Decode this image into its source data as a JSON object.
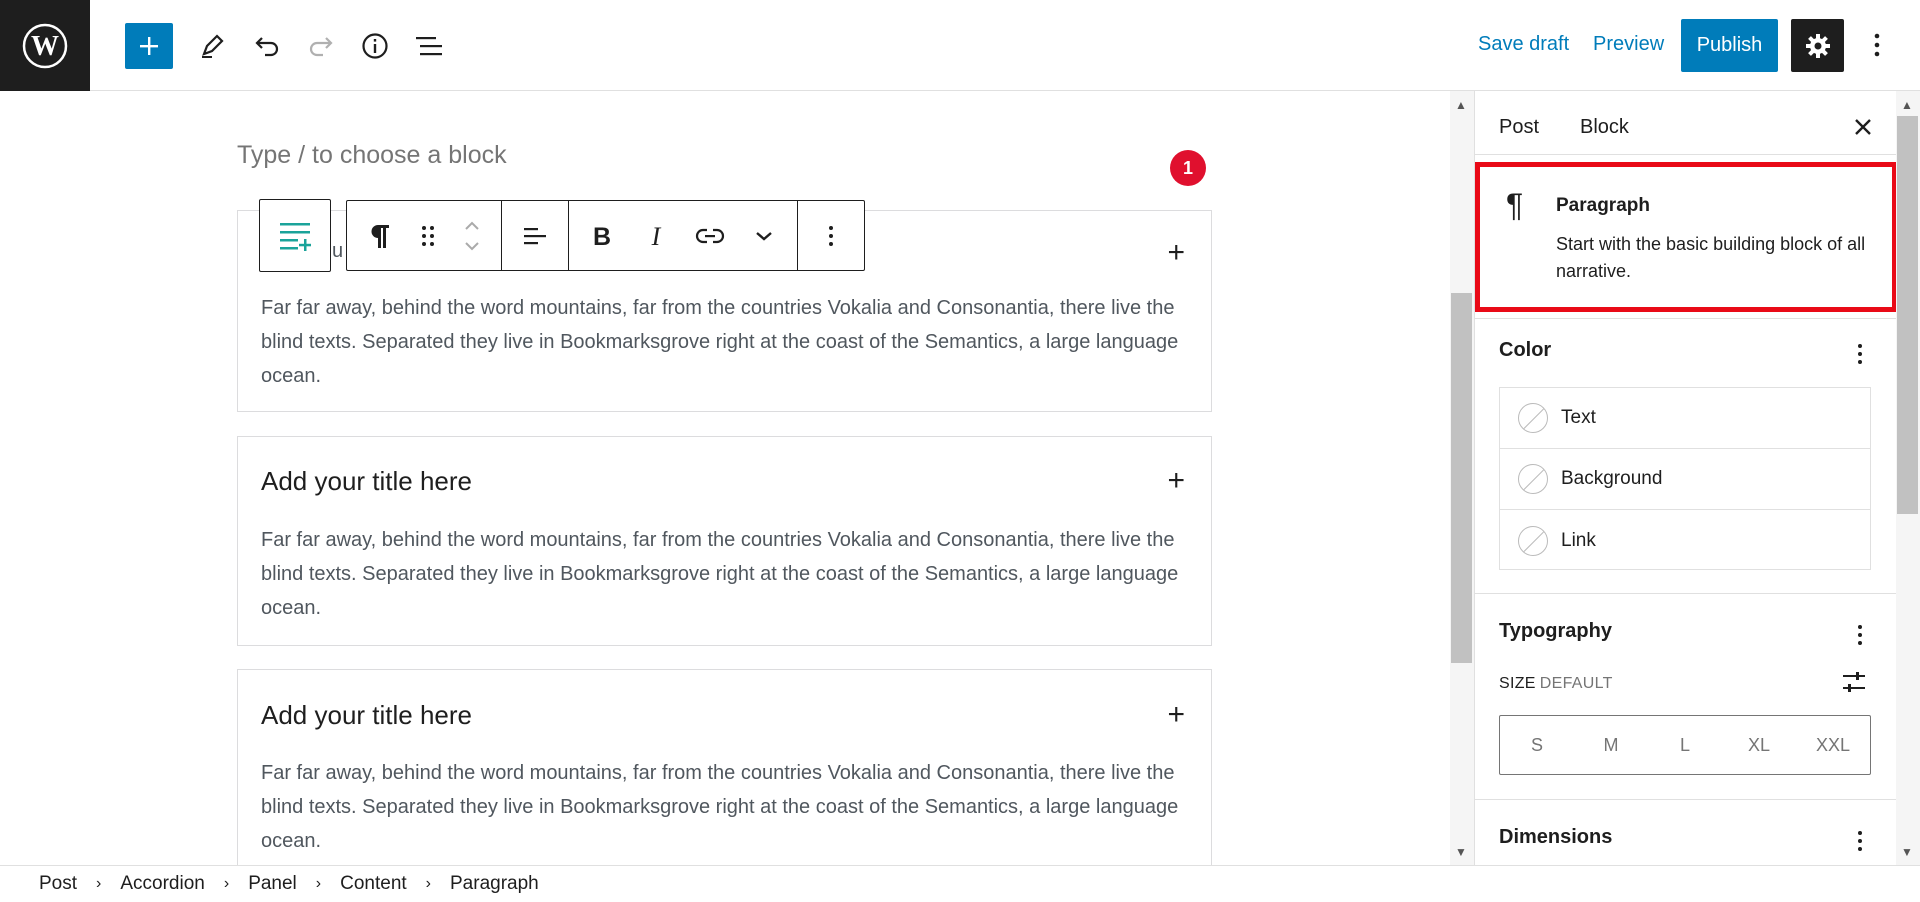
{
  "topbar": {
    "save_draft": "Save draft",
    "preview": "Preview",
    "publish": "Publish"
  },
  "editor": {
    "placeholder": "Type / to choose a block",
    "notice_count": "1",
    "partial_text": "u",
    "panels": [
      {
        "content": "Far far away, behind the word mountains, far from the countries Vokalia and Consonantia, there live the blind texts. Separated they live in Bookmarksgrove right at the coast of the Semantics, a large language ocean."
      },
      {
        "title": "Add your title here",
        "content": "Far far away, behind the word mountains, far from the countries Vokalia and Consonantia, there live the blind texts. Separated they live in Bookmarksgrove right at the coast of the Semantics, a large language ocean."
      },
      {
        "title": "Add your title here",
        "content": "Far far away, behind the word mountains, far from the countries Vokalia and Consonantia, there live the blind texts. Separated they live in Bookmarksgrove right at the coast of the Semantics, a large language ocean."
      }
    ]
  },
  "sidebar": {
    "tabs": [
      "Post",
      "Block"
    ],
    "block_card": {
      "title": "Paragraph",
      "description": "Start with the basic building block of all narrative."
    },
    "color": {
      "title": "Color",
      "items": [
        "Text",
        "Background",
        "Link"
      ]
    },
    "typography": {
      "title": "Typography",
      "size_label": "SIZE",
      "size_value": "DEFAULT",
      "sizes": [
        "S",
        "M",
        "L",
        "XL",
        "XXL"
      ]
    },
    "dimensions": {
      "title": "Dimensions"
    }
  },
  "breadcrumb": [
    "Post",
    "Accordion",
    "Panel",
    "Content",
    "Paragraph"
  ],
  "colors": {
    "accent": "#007cba",
    "highlight": "#e90a17",
    "badge": "#e0102e"
  }
}
